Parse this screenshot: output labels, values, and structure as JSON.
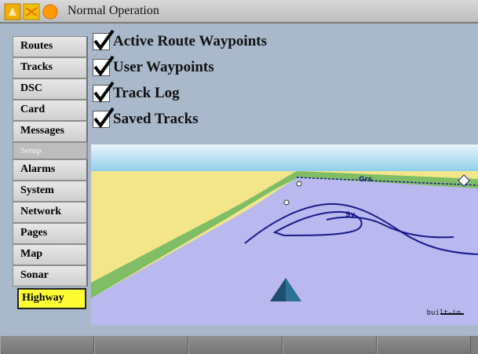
{
  "titlebar": {
    "title": "Normal Operation"
  },
  "sidebar": {
    "tabs": [
      {
        "label": "Routes"
      },
      {
        "label": "Tracks"
      },
      {
        "label": "DSC"
      },
      {
        "label": "Card"
      },
      {
        "label": "Messages"
      }
    ],
    "section_label": "Setup",
    "setup_tabs": [
      {
        "label": "Alarms"
      },
      {
        "label": "System"
      },
      {
        "label": "Network"
      },
      {
        "label": "Pages"
      },
      {
        "label": "Map"
      },
      {
        "label": "Sonar"
      },
      {
        "label": "Highway"
      }
    ],
    "active_tab": "Highway"
  },
  "options": [
    {
      "label": "Active Route Waypoints",
      "checked": true
    },
    {
      "label": "User Waypoints",
      "checked": true
    },
    {
      "label": "Track Log",
      "checked": true
    },
    {
      "label": "Saved Tracks",
      "checked": true
    }
  ],
  "map": {
    "labels": {
      "grs": "Grs",
      "sy": "Sy"
    },
    "scale_label": "built-in",
    "colors": {
      "water": "#b9b9ef",
      "land": "#f2e58a",
      "shore": "#7fbe64",
      "sky": "#bfe3f0",
      "track": "#1a1a8c",
      "vessel": "#1f4f6e"
    }
  },
  "softkeys": [
    "",
    "",
    "",
    "",
    ""
  ]
}
